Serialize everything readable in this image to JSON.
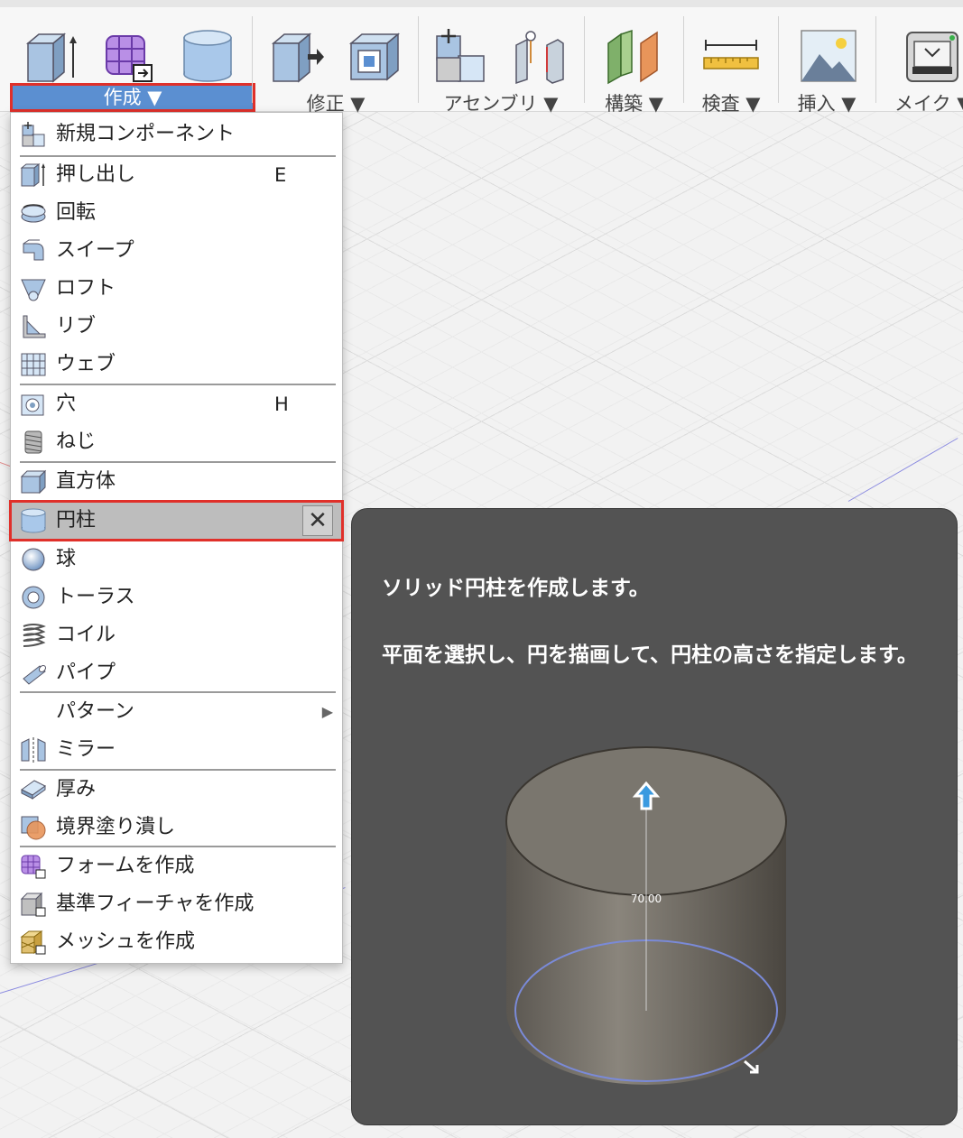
{
  "toolbar": {
    "groups": [
      {
        "label": "作成 ▼"
      },
      {
        "label": "修正 ▼"
      },
      {
        "label": "アセンブリ ▼"
      },
      {
        "label": "構築 ▼"
      },
      {
        "label": "検査 ▼"
      },
      {
        "label": "挿入 ▼"
      },
      {
        "label": "メイク ▼"
      }
    ]
  },
  "menu": {
    "items": [
      {
        "label": "新規コンポーネント",
        "icon": "new-component-icon"
      },
      {
        "label": "押し出し",
        "shortcut": "E",
        "icon": "extrude-icon"
      },
      {
        "label": "回転",
        "icon": "revolve-icon"
      },
      {
        "label": "スイープ",
        "icon": "sweep-icon"
      },
      {
        "label": "ロフト",
        "icon": "loft-icon"
      },
      {
        "label": "リブ",
        "icon": "rib-icon"
      },
      {
        "label": "ウェブ",
        "icon": "web-icon"
      },
      {
        "label": "穴",
        "shortcut": "H",
        "icon": "hole-icon"
      },
      {
        "label": "ねじ",
        "icon": "thread-icon"
      },
      {
        "label": "直方体",
        "icon": "box-icon"
      },
      {
        "label": "円柱",
        "icon": "cylinder-icon",
        "close": "✕"
      },
      {
        "label": "球",
        "icon": "sphere-icon"
      },
      {
        "label": "トーラス",
        "icon": "torus-icon"
      },
      {
        "label": "コイル",
        "icon": "coil-icon"
      },
      {
        "label": "パイプ",
        "icon": "pipe-icon"
      },
      {
        "label": "パターン",
        "arrow": "▶"
      },
      {
        "label": "ミラー",
        "icon": "mirror-icon"
      },
      {
        "label": "厚み",
        "icon": "thicken-icon"
      },
      {
        "label": "境界塗り潰し",
        "icon": "boundary-fill-icon"
      },
      {
        "label": "フォームを作成",
        "icon": "create-form-icon"
      },
      {
        "label": "基準フィーチャを作成",
        "icon": "base-feature-icon"
      },
      {
        "label": "メッシュを作成",
        "icon": "create-mesh-icon"
      }
    ]
  },
  "tooltip": {
    "title": "ソリッド円柱を作成します。",
    "description": "平面を選択し、円を描画して、円柱の高さを指定します。",
    "dimension_label": "70.00"
  },
  "colors": {
    "accent": "#5b8fd1",
    "highlight_border": "#e0302a",
    "tooltip_bg": "#535353"
  }
}
